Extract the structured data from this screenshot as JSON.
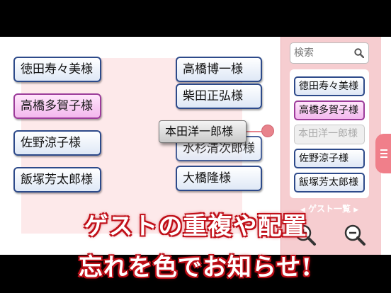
{
  "seating": {
    "left_column": [
      "徳田寿々美様",
      "高橋多賀子様",
      "佐野涼子様",
      "飯塚芳太郎様"
    ],
    "right_column": [
      "高橋博一様",
      "柴田正弘様",
      "水杉清次郎様",
      "大橋隆様"
    ],
    "dragging_card": "本田洋一郎様"
  },
  "panel": {
    "search_label": "検索",
    "guests": [
      "徳田寿々美様",
      "高橋多賀子様",
      "本田洋一郎様",
      "佐野涼子様",
      "飯塚芳太郎様"
    ],
    "guest_list_label": "ゲスト一覧"
  },
  "caption": {
    "line1": "ゲストの重複や配置",
    "line2": "忘れを色でお知らせ!"
  },
  "colors": {
    "duplicate_highlight": "#f3b8ee",
    "placed_disabled": "#efefef",
    "accent": "#f07f8a",
    "caption_glow": "#c0111a"
  }
}
